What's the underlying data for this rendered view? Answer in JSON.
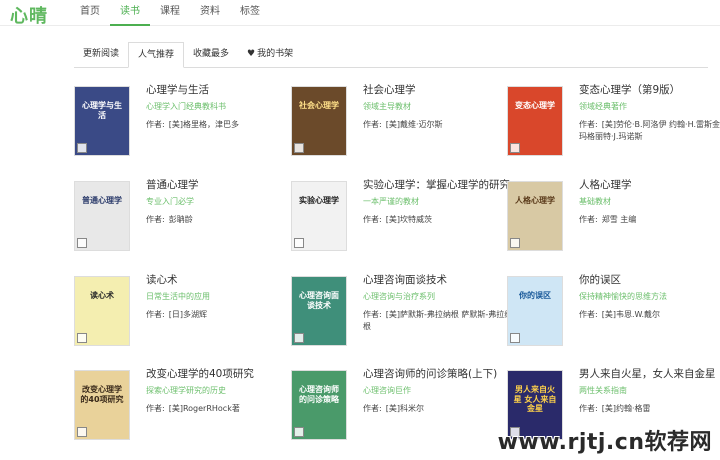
{
  "brand": {
    "logo_text": "心晴",
    "accent": "#4caf50"
  },
  "nav": {
    "items": [
      {
        "label": "首页",
        "active": false
      },
      {
        "label": "读书",
        "active": true
      },
      {
        "label": "课程",
        "active": false
      },
      {
        "label": "资料",
        "active": false
      },
      {
        "label": "标签",
        "active": false
      }
    ]
  },
  "tabs": [
    {
      "label": "更新阅读",
      "active": false
    },
    {
      "label": "人气推荐",
      "active": true
    },
    {
      "label": "收藏最多",
      "active": false
    },
    {
      "label": "我的书架",
      "active": false,
      "icon": "heart-icon"
    }
  ],
  "author_prefix": "作者:",
  "books": [
    {
      "title": "心理学与生活",
      "subtitle": "心理学入门经典教科书",
      "author": "[美]格里格，津巴多",
      "cover_color": "#3a4a86",
      "cover_text": "心理学与生活",
      "cover_text_color": "#ffffff"
    },
    {
      "title": "社会心理学",
      "subtitle": "领域主导教材",
      "author": "[美]戴维·迈尔斯",
      "cover_color": "#6b4a2a",
      "cover_text": "社会心理学",
      "cover_text_color": "#ffe08a"
    },
    {
      "title": "变态心理学（第9版）",
      "subtitle": "领域经典著作",
      "author": "[美]劳伦·B.阿洛伊 约翰·H.雷斯金德 玛格丽特·J.玛诺斯",
      "cover_color": "#d9472b",
      "cover_text": "变态心理学",
      "cover_text_color": "#ffffff"
    },
    {
      "title": "普通心理学",
      "subtitle": "专业入门必学",
      "author": "彭聃龄",
      "cover_color": "#e8e8e8",
      "cover_text": "普通心理学",
      "cover_text_color": "#2a3a6a"
    },
    {
      "title": "实验心理学：掌握心理学的研究",
      "subtitle": "一本严谨的教材",
      "author": "[美]坎特威茨",
      "cover_color": "#f2f2f2",
      "cover_text": "实验心理学",
      "cover_text_color": "#222222"
    },
    {
      "title": "人格心理学",
      "subtitle": "基础教材",
      "author": "郑雪 主编",
      "cover_color": "#d8c9a4",
      "cover_text": "人格心理学",
      "cover_text_color": "#5a3a1a"
    },
    {
      "title": "读心术",
      "subtitle": "日常生活中的应用",
      "author": "[日]多湖辉",
      "cover_color": "#f4eeb0",
      "cover_text": "读心术",
      "cover_text_color": "#2a2a2a"
    },
    {
      "title": "心理咨询面谈技术",
      "subtitle": "心理咨询与治疗系列",
      "author": "[美]萨默斯-弗拉纳根 萨默斯-弗拉纳根",
      "cover_color": "#3f8f7a",
      "cover_text": "心理咨询面谈技术",
      "cover_text_color": "#ffffff"
    },
    {
      "title": "你的误区",
      "subtitle": "保持精神愉快的思维方法",
      "author": "[美]韦恩.W.戴尔",
      "cover_color": "#cfe6f5",
      "cover_text": "你的误区",
      "cover_text_color": "#1a5a9a"
    },
    {
      "title": "改变心理学的40项研究",
      "subtitle": "探索心理学研究的历史",
      "author": "[美]RogerRHock著",
      "cover_color": "#e9d29a",
      "cover_text": "改变心理学的40项研究",
      "cover_text_color": "#3a2a1a"
    },
    {
      "title": "心理咨询师的问诊策略(上下)",
      "subtitle": "心理咨询巨作",
      "author": "[美]科米尔",
      "cover_color": "#4a9a6a",
      "cover_text": "心理咨询师的问诊策略",
      "cover_text_color": "#ffffff"
    },
    {
      "title": "男人来自火星，女人来自金星",
      "subtitle": "两性关系指南",
      "author": "[美]约翰·格雷",
      "cover_color": "#2a2a6a",
      "cover_text": "男人来自火星 女人来自金星",
      "cover_text_color": "#ffd24a"
    }
  ],
  "watermark": "www.rjtj.cn软荐网"
}
